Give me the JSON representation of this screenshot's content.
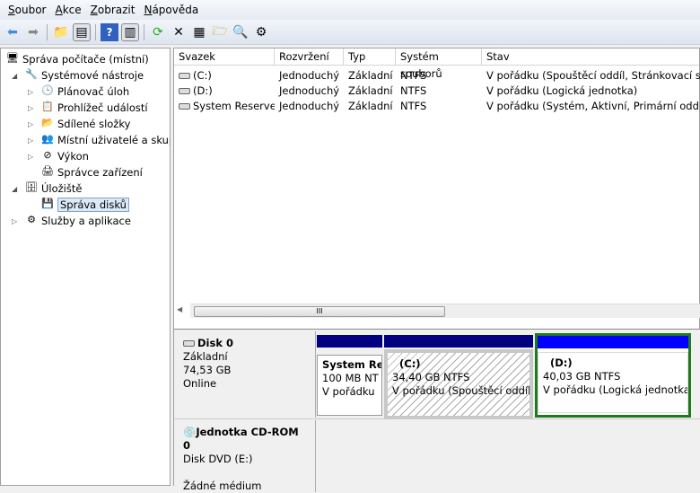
{
  "menu": [
    "Soubor",
    "Akce",
    "Zobrazit",
    "Nápověda"
  ],
  "tree": [
    {
      "label": "Správa počítače (místní)",
      "level": 0,
      "arrow": ""
    },
    {
      "label": "Systémové nástroje",
      "level": 1,
      "arrow": "◢"
    },
    {
      "label": "Plánovač úloh",
      "level": 2,
      "arrow": "▷"
    },
    {
      "label": "Prohlížeč událostí",
      "level": 2,
      "arrow": "▷"
    },
    {
      "label": "Sdílené složky",
      "level": 2,
      "arrow": "▷"
    },
    {
      "label": "Místní uživatelé a skupiny",
      "level": 2,
      "arrow": "▷"
    },
    {
      "label": "Výkon",
      "level": 2,
      "arrow": "▷"
    },
    {
      "label": "Správce zařízení",
      "level": 2,
      "arrow": ""
    },
    {
      "label": "Úložiště",
      "level": 1,
      "arrow": "◢"
    },
    {
      "label": "Správa disků",
      "level": 2,
      "arrow": "",
      "selected": true
    },
    {
      "label": "Služby a aplikace",
      "level": 1,
      "arrow": "▷"
    }
  ],
  "columns": [
    "Svazek",
    "Rozvržení",
    "Typ",
    "Systém souborů",
    "Stav"
  ],
  "volumes": [
    [
      "(C:)",
      "Jednoduchý",
      "Základní",
      "NTFS",
      "V pořádku (Spouštěcí oddíl, Stránkovací soubor"
    ],
    [
      "(D:)",
      "Jednoduchý",
      "Základní",
      "NTFS",
      "V pořádku (Logická jednotka)"
    ],
    [
      "System Reserved",
      "Jednoduchý",
      "Základní",
      "NTFS",
      "V pořádku (Systém, Aktivní, Primární oddíl)"
    ]
  ],
  "scroll_grip": "III",
  "disk0": {
    "name": "Disk 0",
    "type": "Základní",
    "size": "74,53 GB",
    "status": "Online",
    "partitions": [
      {
        "name": "System Re",
        "size": "100 MB NT",
        "status": "V pořádku"
      },
      {
        "name": "(C:)",
        "size": "34,40 GB NTFS",
        "status": "V pořádku (Spouštěcí oddíl, S"
      },
      {
        "name": "(D:)",
        "size": "40,03 GB NTFS",
        "status": "V pořádku (Logická jednotka"
      }
    ]
  },
  "cdrom": {
    "name": "Jednotka CD-ROM 0",
    "type": "Disk DVD (E:)",
    "status": "Žádné médium"
  },
  "colors": {
    "primary": "#000080",
    "logical": "#0000ff",
    "selected": "#1f7a1f"
  }
}
